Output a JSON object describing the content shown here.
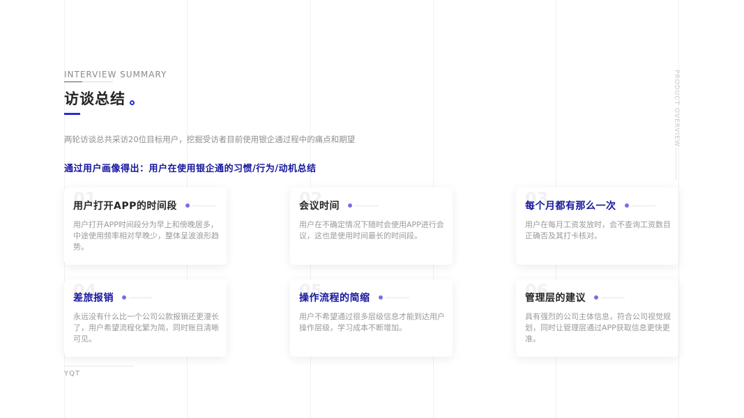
{
  "header": {
    "eyebrow": "INTERVIEW SUMMARY",
    "title": "访谈总结",
    "intro": "两轮访谈总共采访20位目标用户，挖掘受访者目前使用银企通过程中的痛点和期望",
    "highlight": "通过用户画像得出：用户在使用银企通的习惯/行为/动机总结"
  },
  "side_label": "PRODUCT OVERVIEW",
  "cards": [
    {
      "num": "01",
      "title": "用户打开APP的时间段",
      "body": "用户打开APP时间段分为早上和傍晚居多，中途使用频率相对早晚少，整体呈波浪形趋势。"
    },
    {
      "num": "02",
      "title": "会议时间",
      "body": "用户在不确定情况下随时会使用APP进行会议，这也是使用时间最长的时间段。"
    },
    {
      "num": "03",
      "title": "每个月都有那么一次",
      "body": "用户在每月工资发放时，会不查询工资数目正确否及其打卡核对。"
    },
    {
      "num": "04",
      "title": "差旅报销",
      "body": "永远没有什么比一个公司公款报销还更漫长了，用户希望流程化繁为简，同时账目清晰可见。"
    },
    {
      "num": "05",
      "title": "操作流程的简缩",
      "body": "用户不希望通过很多层级信息才能到达用户操作层级，学习成本不断增加。"
    },
    {
      "num": "06",
      "title": "管理层的建议",
      "body": "具有强烈的公司主体信息，符合公司视觉规划，同时让管理层通过APP获取信息更快更准。"
    }
  ],
  "footer": "YQT",
  "colors": {
    "accent": "#2b2bd1",
    "title_blue": "#16169e",
    "dot": "#7a6ee0"
  }
}
